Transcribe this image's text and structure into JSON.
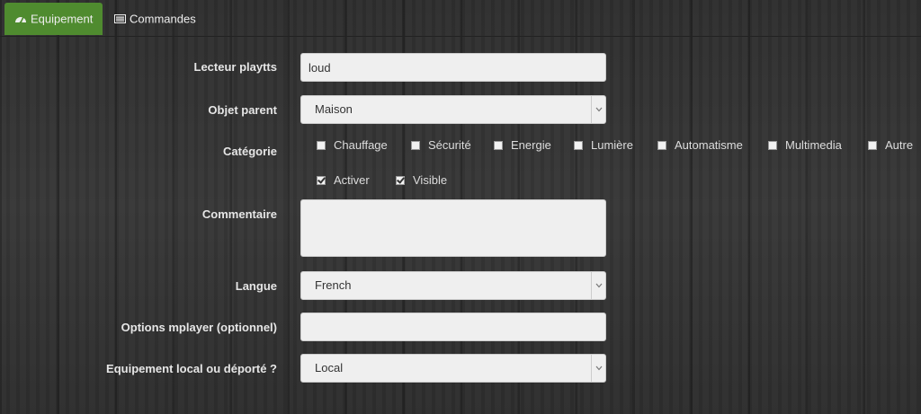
{
  "tabs": [
    {
      "label": "Equipement",
      "icon": "dashboard-icon",
      "active": true
    },
    {
      "label": "Commandes",
      "icon": "list-icon",
      "active": false
    }
  ],
  "form": {
    "lecteur": {
      "label": "Lecteur playtts",
      "value": "loud"
    },
    "objet_parent": {
      "label": "Objet parent",
      "value": "Maison"
    },
    "categorie": {
      "label": "Catégorie",
      "options": [
        "Chauffage",
        "Sécurité",
        "Energie",
        "Lumière",
        "Automatisme",
        "Multimedia",
        "Autre"
      ]
    },
    "activer": {
      "label": "Activer",
      "checked": true
    },
    "visible": {
      "label": "Visible",
      "checked": true
    },
    "commentaire": {
      "label": "Commentaire",
      "value": ""
    },
    "langue": {
      "label": "Langue",
      "value": "French"
    },
    "options_mplayer": {
      "label": "Options mplayer (optionnel)",
      "value": ""
    },
    "equipement_local": {
      "label": "Equipement local ou déporté ?",
      "value": "Local"
    }
  },
  "colors": {
    "active_tab": "#4f8b2f",
    "field_bg": "#efefef"
  }
}
